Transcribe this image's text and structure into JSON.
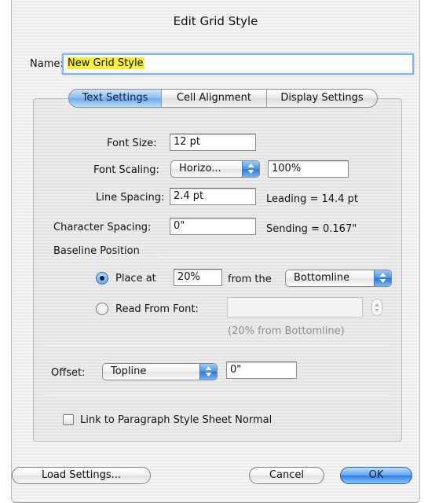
{
  "dialog": {
    "title": "Edit Grid Style"
  },
  "name": {
    "label": "Name:",
    "value": "New Grid Style"
  },
  "tabs": [
    {
      "label": "Text Settings",
      "active": true
    },
    {
      "label": "Cell Alignment",
      "active": false
    },
    {
      "label": "Display Settings",
      "active": false
    }
  ],
  "font_size": {
    "label": "Font Size:",
    "value": "12 pt"
  },
  "font_scaling": {
    "label": "Font Scaling:",
    "popup_value": "Horizo...",
    "value": "100%"
  },
  "line_spacing": {
    "label": "Line Spacing:",
    "value": "2.4 pt",
    "info": "Leading = 14.4 pt"
  },
  "character_spacing": {
    "label": "Character Spacing:",
    "value": "0\"",
    "info": "Sending = 0.167\""
  },
  "baseline": {
    "heading": "Baseline Position",
    "place_at": {
      "label": "Place at",
      "value": "20%",
      "from_label": "from the",
      "from_value": "Bottomline",
      "selected": true
    },
    "read_from_font": {
      "label": "Read From Font:",
      "value": "",
      "hint": "(20% from Bottomline)",
      "selected": false
    }
  },
  "offset": {
    "label": "Offset:",
    "popup_value": "Topline",
    "value": "0\""
  },
  "link_checkbox": {
    "label": "Link to Paragraph Style Sheet Normal",
    "checked": false
  },
  "buttons": {
    "load": "Load Settings...",
    "cancel": "Cancel",
    "ok": "OK"
  },
  "colors": {
    "accent": "#4b90e2",
    "highlight": "#f8ef3c",
    "focus_ring": "#84b2e8"
  },
  "icons": {
    "popup": "up-down-arrows-icon",
    "radio": "radio-icon",
    "checkbox": "checkbox-icon"
  }
}
